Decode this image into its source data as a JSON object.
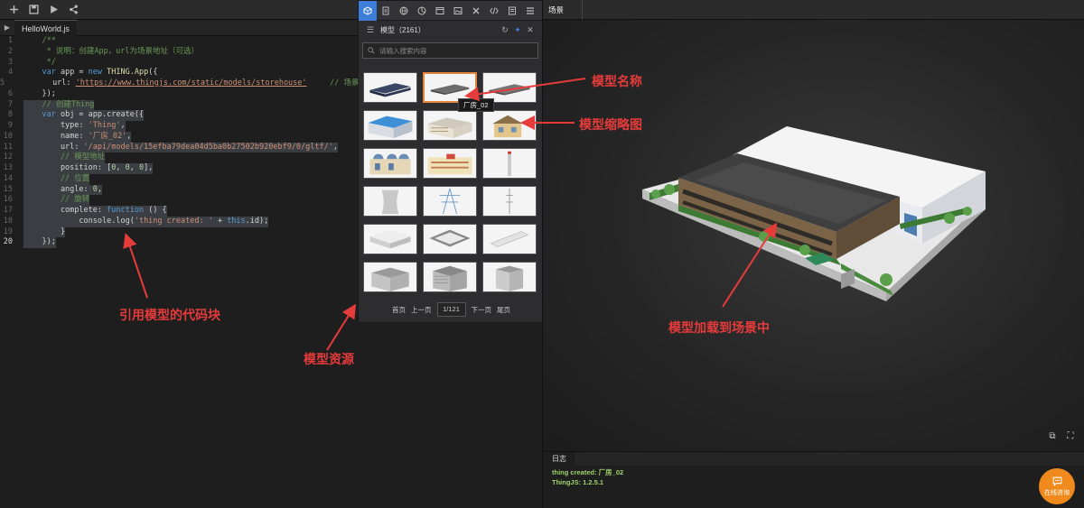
{
  "toolbar": {
    "icons": [
      "add-icon",
      "save-icon",
      "run-icon",
      "share-icon"
    ]
  },
  "editor": {
    "tab_label": "HelloWorld.js",
    "lines": [
      {
        "n": "1",
        "segments": [
          {
            "t": "    /**",
            "c": "com"
          }
        ]
      },
      {
        "n": "2",
        "segments": [
          {
            "t": "     * 说明：创建App，url为场景地址（可选）",
            "c": "com"
          }
        ]
      },
      {
        "n": "3",
        "segments": [
          {
            "t": "     */",
            "c": "com"
          }
        ]
      },
      {
        "n": "4",
        "segments": [
          {
            "t": "    ",
            "c": ""
          },
          {
            "t": "var",
            "c": "kw"
          },
          {
            "t": " app = ",
            "c": ""
          },
          {
            "t": "new",
            "c": "kw"
          },
          {
            "t": " ",
            "c": ""
          },
          {
            "t": "THING.App",
            "c": "cls"
          },
          {
            "t": "({",
            "c": ""
          }
        ]
      },
      {
        "n": "5",
        "segments": [
          {
            "t": "        url: ",
            "c": ""
          },
          {
            "t": "'https://www.thingjs.com/static/models/storehouse'",
            "c": "url"
          },
          {
            "t": "     // 场景地址",
            "c": "com"
          }
        ]
      },
      {
        "n": "6",
        "segments": [
          {
            "t": "    });",
            "c": ""
          }
        ]
      },
      {
        "n": "7",
        "segments": [
          {
            "t": "    // 创建Thing",
            "c": "com"
          }
        ],
        "sel": true
      },
      {
        "n": "8",
        "segments": [
          {
            "t": "    ",
            "c": ""
          },
          {
            "t": "var",
            "c": "kw"
          },
          {
            "t": " obj = app.create({",
            "c": ""
          }
        ],
        "sel": true
      },
      {
        "n": "9",
        "segments": [
          {
            "t": "        type: ",
            "c": ""
          },
          {
            "t": "'Thing'",
            "c": "str"
          },
          {
            "t": ",",
            "c": ""
          }
        ],
        "sel": true
      },
      {
        "n": "10",
        "segments": [
          {
            "t": "        name: ",
            "c": ""
          },
          {
            "t": "'厂房_02'",
            "c": "str"
          },
          {
            "t": ",",
            "c": ""
          }
        ],
        "sel": true
      },
      {
        "n": "11",
        "segments": [
          {
            "t": "        url: ",
            "c": ""
          },
          {
            "t": "'/api/models/15efba79dea04d5ba0b27502b920ebf9/0/gltf/'",
            "c": "str"
          },
          {
            "t": ",",
            "c": ""
          }
        ],
        "sel": true
      },
      {
        "n": "12",
        "segments": [
          {
            "t": "        // 模型地址",
            "c": "com"
          }
        ],
        "sel": true
      },
      {
        "n": "13",
        "segments": [
          {
            "t": "        position: [",
            "c": ""
          },
          {
            "t": "0",
            "c": "num"
          },
          {
            "t": ", ",
            "c": ""
          },
          {
            "t": "0",
            "c": "num"
          },
          {
            "t": ", ",
            "c": ""
          },
          {
            "t": "0",
            "c": "num"
          },
          {
            "t": "],",
            "c": ""
          }
        ],
        "sel": true
      },
      {
        "n": "14",
        "segments": [
          {
            "t": "        // 位置",
            "c": "com"
          }
        ],
        "sel": true
      },
      {
        "n": "15",
        "segments": [
          {
            "t": "        angle: ",
            "c": ""
          },
          {
            "t": "0",
            "c": "num"
          },
          {
            "t": ",",
            "c": ""
          }
        ],
        "sel": true
      },
      {
        "n": "16",
        "segments": [
          {
            "t": "        // 旋转",
            "c": "com"
          }
        ],
        "sel": true
      },
      {
        "n": "17",
        "segments": [
          {
            "t": "        complete: ",
            "c": ""
          },
          {
            "t": "function",
            "c": "kw"
          },
          {
            "t": " () {",
            "c": ""
          }
        ],
        "sel": true
      },
      {
        "n": "18",
        "segments": [
          {
            "t": "            console.log(",
            "c": ""
          },
          {
            "t": "'thing created: '",
            "c": "str"
          },
          {
            "t": " + ",
            "c": ""
          },
          {
            "t": "this",
            "c": "kw"
          },
          {
            "t": ".id);",
            "c": ""
          }
        ],
        "sel": true
      },
      {
        "n": "19",
        "segments": [
          {
            "t": "        }",
            "c": ""
          }
        ],
        "sel": true
      },
      {
        "n": "20",
        "segments": [
          {
            "t": "    });",
            "c": ""
          }
        ],
        "sel": true,
        "active": true
      }
    ]
  },
  "panel": {
    "icons": [
      "cube-icon",
      "file-icon",
      "globe-icon",
      "chart-icon",
      "window-icon",
      "image-icon",
      "tools-icon",
      "code-icon",
      "note-icon",
      "list-icon"
    ],
    "title": "模型（2161）",
    "search_placeholder": "请输入搜索内容",
    "tooltip": "厂房_02",
    "pager": {
      "first": "首页",
      "prev": "上一页",
      "page": "1/121",
      "next": "下一页",
      "last": "尾页"
    }
  },
  "scene": {
    "tab_label": "场景"
  },
  "log": {
    "tab_label": "日志",
    "lines": [
      "thing created: 厂房_02",
      "ThingJS: 1.2.5.1"
    ]
  },
  "consult": {
    "label": "在线咨询"
  },
  "annotations": {
    "model_name": "模型名称",
    "model_thumb": "模型缩略图",
    "code_block": "引用模型的代码块",
    "model_resource": "模型资源",
    "model_loaded": "模型加载到场景中"
  },
  "colors": {
    "accent": "#3c7dd9",
    "selected_thumb": "#e2863b",
    "annotation": "#e63b3b",
    "log_text": "#9ed26a",
    "consult": "#f08a1d"
  }
}
